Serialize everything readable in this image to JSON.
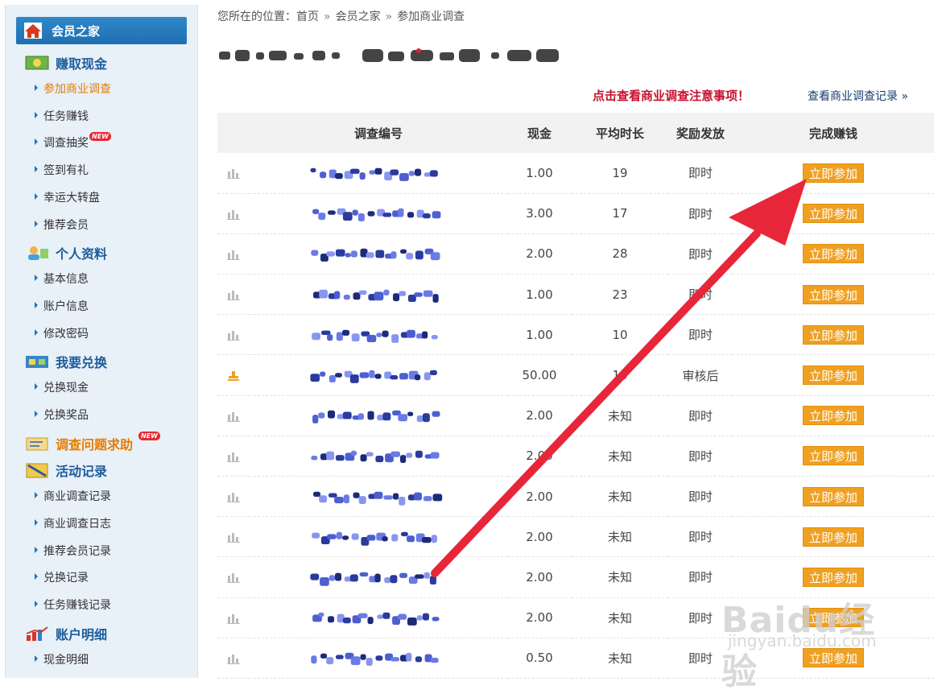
{
  "sidebar": {
    "header": "会员之家",
    "sections": [
      {
        "label": "赚取现金",
        "items": [
          "参加商业调查",
          "任务赚钱",
          "调查抽奖",
          "签到有礼",
          "幸运大转盘",
          "推荐会员"
        ]
      },
      {
        "label": "个人资料",
        "items": [
          "基本信息",
          "账户信息",
          "修改密码"
        ]
      },
      {
        "label": "我要兑换",
        "items": [
          "兑换现金",
          "兑换奖品"
        ]
      },
      {
        "label": "调查问题求助",
        "items": []
      },
      {
        "label": "活动记录",
        "items": [
          "商业调查记录",
          "商业调查日志",
          "推荐会员记录",
          "兑换记录",
          "任务赚钱记录"
        ]
      },
      {
        "label": "账户明细",
        "items": [
          "现金明细"
        ]
      }
    ],
    "new_badge": "NEW"
  },
  "breadcrumb": {
    "prefix": "您所在的位置：",
    "items": [
      "首页",
      "会员之家",
      "参加商业调查"
    ],
    "separator": "»"
  },
  "notice_link": "点击查看商业调查注意事项！",
  "records_link": "查看商业调查记录 »",
  "table": {
    "headers": [
      "调查编号",
      "现金",
      "平均时长",
      "奖励发放",
      "完成赚钱"
    ],
    "button_label": "立即参加",
    "rows": [
      {
        "cash": "1.00",
        "time": "19",
        "reward": "即时"
      },
      {
        "cash": "3.00",
        "time": "17",
        "reward": "即时"
      },
      {
        "cash": "2.00",
        "time": "28",
        "reward": "即时"
      },
      {
        "cash": "1.00",
        "time": "23",
        "reward": "即时"
      },
      {
        "cash": "1.00",
        "time": "10",
        "reward": "即时"
      },
      {
        "cash": "50.00",
        "time": "10",
        "reward": "审核后"
      },
      {
        "cash": "2.00",
        "time": "未知",
        "reward": "即时"
      },
      {
        "cash": "2.00",
        "time": "未知",
        "reward": "即时"
      },
      {
        "cash": "2.00",
        "time": "未知",
        "reward": "即时"
      },
      {
        "cash": "2.00",
        "time": "未知",
        "reward": "即时"
      },
      {
        "cash": "2.00",
        "time": "未知",
        "reward": "即时"
      },
      {
        "cash": "2.00",
        "time": "未知",
        "reward": "即时"
      },
      {
        "cash": "0.50",
        "time": "未知",
        "reward": "即时"
      }
    ]
  },
  "watermark": {
    "main": "Baidu经验",
    "sub": "jingyan.baidu.com"
  },
  "colors": {
    "accent_blue": "#1f6fb1",
    "button_orange": "#f0a020",
    "notice_red": "#c8102e",
    "arrow_red": "#e8263a"
  }
}
